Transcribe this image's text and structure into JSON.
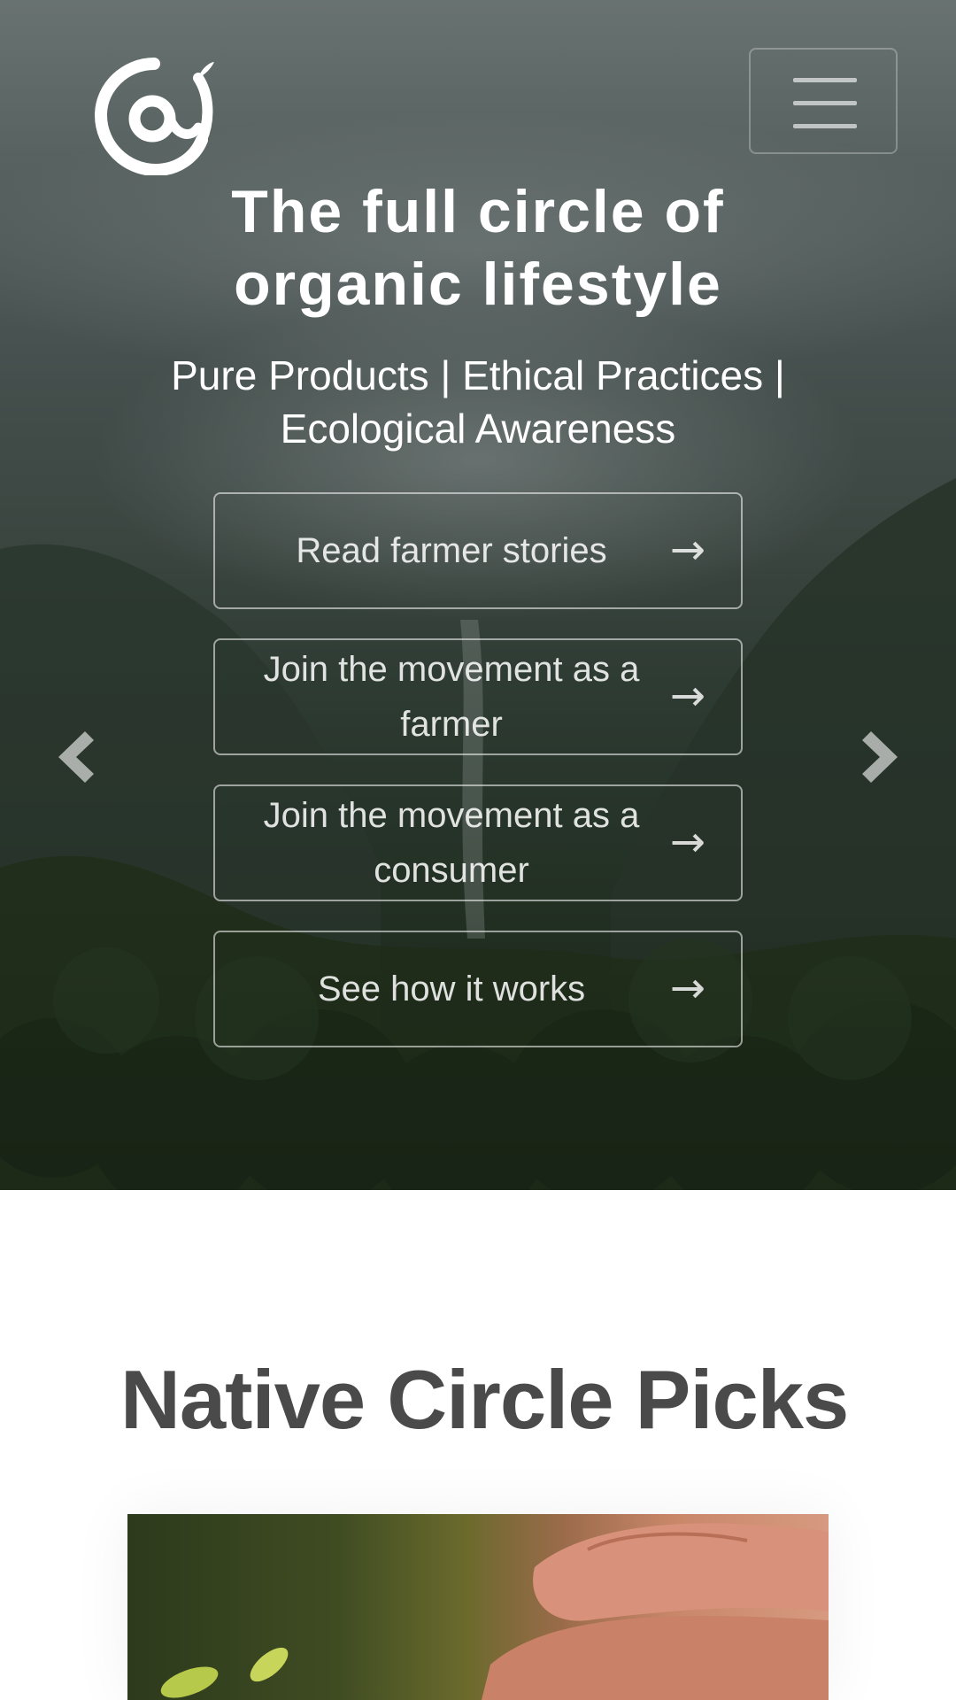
{
  "header": {
    "logo_icon": "native-circle-swirl-logo",
    "menu_icon": "hamburger-menu-icon"
  },
  "hero": {
    "title": "The full circle of organic lifestyle",
    "subtitle": "Pure Products | Ethical Practices | Ecological Awareness",
    "buttons": [
      {
        "label": "Read farmer stories",
        "icon": "arrow-right-icon",
        "arrow": "→"
      },
      {
        "label": "Join the movement as a farmer",
        "icon": "arrow-right-icon",
        "arrow": "→"
      },
      {
        "label": "Join the movement as a consumer",
        "icon": "arrow-right-icon",
        "arrow": "→"
      },
      {
        "label": "See how it works",
        "icon": "arrow-right-icon",
        "arrow": "→"
      }
    ],
    "prev_icon": "chevron-left-icon",
    "next_icon": "chevron-right-icon"
  },
  "picks": {
    "title": "Native Circle Picks"
  },
  "colors": {
    "heading": "#4a4a4a",
    "hero_text": "#ffffff",
    "page_background": "#ffffff"
  }
}
